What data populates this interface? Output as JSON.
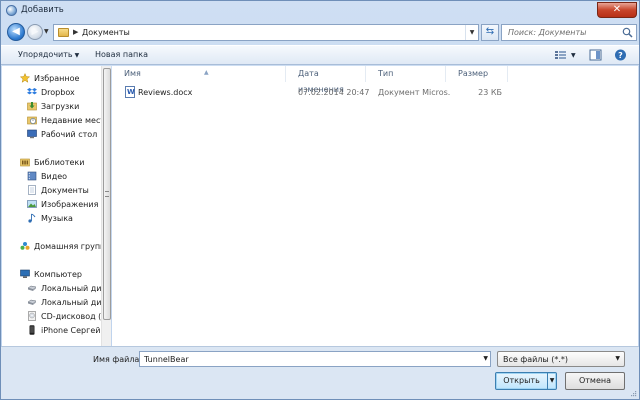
{
  "window": {
    "title": "Добавить",
    "close_label": "✕"
  },
  "nav": {
    "path_segment": "Документы",
    "search_placeholder": "Поиск: Документы"
  },
  "toolbar": {
    "organize_label": "Упорядочить",
    "new_folder_label": "Новая папка"
  },
  "sidebar": {
    "items": [
      {
        "label": "Избранное",
        "icon": "star-icon",
        "group": true
      },
      {
        "label": "Dropbox",
        "icon": "dropbox-icon"
      },
      {
        "label": "Загрузки",
        "icon": "downloads-icon"
      },
      {
        "label": "Недавние места",
        "icon": "recent-places-icon"
      },
      {
        "label": "Рабочий стол",
        "icon": "desktop-icon"
      },
      {
        "label": "Библиотеки",
        "icon": "libraries-icon",
        "group": true
      },
      {
        "label": "Видео",
        "icon": "video-icon"
      },
      {
        "label": "Документы",
        "icon": "documents-icon"
      },
      {
        "label": "Изображения",
        "icon": "pictures-icon"
      },
      {
        "label": "Музыка",
        "icon": "music-icon"
      },
      {
        "label": "Домашняя группа",
        "icon": "homegroup-icon",
        "group": true
      },
      {
        "label": "Компьютер",
        "icon": "computer-icon",
        "group": true
      },
      {
        "label": "Локальный диск",
        "icon": "local-disk-icon"
      },
      {
        "label": "Локальный диск",
        "icon": "local-disk-icon"
      },
      {
        "label": "CD-дисковод (F:)",
        "icon": "cd-drive-icon"
      },
      {
        "label": "iPhone Сергей",
        "icon": "iphone-icon"
      }
    ]
  },
  "filelist": {
    "columns": [
      "Имя",
      "Дата изменения",
      "Тип",
      "Размер"
    ],
    "rows": [
      {
        "name": "Reviews.docx",
        "modified": "07.02.2014 20:47",
        "type": "Документ Micros...",
        "size": "23 КБ"
      }
    ]
  },
  "footer": {
    "filename_label": "Имя файла:",
    "filename_value": "TunnelBear",
    "filetype_value": "Все файлы (*.*)",
    "open_label": "Открыть",
    "cancel_label": "Отмена"
  }
}
